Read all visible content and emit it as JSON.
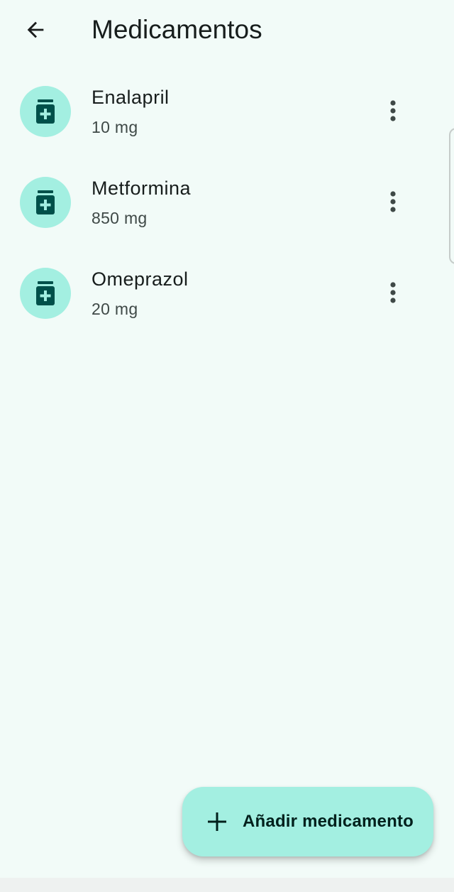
{
  "appbar": {
    "title": "Medicamentos",
    "back_icon": "arrow-back-icon"
  },
  "medications": [
    {
      "name": "Enalapril",
      "dose": "10 mg",
      "icon": "medication-bottle-icon",
      "menu_icon": "more-vert-icon"
    },
    {
      "name": "Metformina",
      "dose": "850 mg",
      "icon": "medication-bottle-icon",
      "menu_icon": "more-vert-icon"
    },
    {
      "name": "Omeprazol",
      "dose": "20 mg",
      "icon": "medication-bottle-icon",
      "menu_icon": "more-vert-icon"
    }
  ],
  "fab": {
    "label": "Añadir medicamento",
    "icon": "add-icon"
  },
  "colors": {
    "background": "#f2fbf8",
    "accent_container": "#a3efe1",
    "icon_foreground": "#00504a",
    "text_primary": "#171d1c",
    "text_secondary": "#3f4947"
  }
}
